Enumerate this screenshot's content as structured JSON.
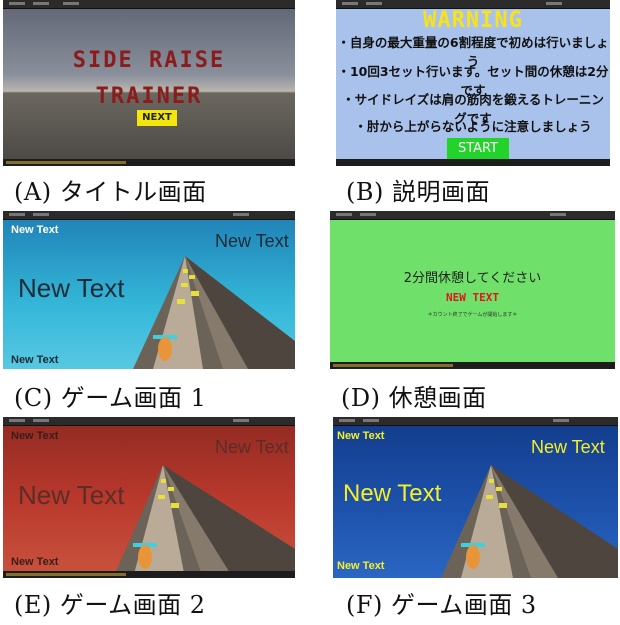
{
  "panels": {
    "a": {
      "caption": "(A) タイトル画面",
      "title_line1": "SIDE RAISE",
      "title_line2": "TRAINER",
      "next_label": "NEXT"
    },
    "b": {
      "caption": "(B) 説明画面",
      "warning_title": "WARNING",
      "lines": [
        "・自身の最大重量の6割程度で初めは行いましょう",
        "・10回3セット行います。セット間の休憩は2分です",
        "・サイドレイズは肩の筋肉を鍛えるトレーニングです",
        "・肘から上がらないように注意しましょう"
      ],
      "start_label": "START"
    },
    "c": {
      "caption": "(C) ゲーム画面 1",
      "text_top_left": "New Text",
      "text_top_right": "New Text",
      "text_center": "New Text",
      "text_bottom_left": "New Text"
    },
    "d": {
      "caption": "(D) 休憩画面",
      "message": "2分間休憩してください",
      "red_text": "NEW TEXT",
      "small_text": "＊カウント終了でゲームが開始します＊"
    },
    "e": {
      "caption": "(E) ゲーム画面 2",
      "text_top_left": "New Text",
      "text_top_right": "New Text",
      "text_center": "New Text",
      "text_bottom_left": "New Text"
    },
    "f": {
      "caption": "(F) ゲーム画面 3",
      "text_top_left": "New Text",
      "text_top_right": "New Text",
      "text_center": "New Text",
      "text_bottom_left": "New Text"
    }
  },
  "colors": {
    "title_bg_sky": "#8a8f9c",
    "warning_bg": "#a9c2ec",
    "game1_sky": "#34b7d8",
    "rest_bg": "#6fe069",
    "game2_sky": "#b8382c",
    "game3_sky": "#1c4fa8",
    "accent_yellow": "#f2e60c",
    "start_green": "#22d42a"
  }
}
